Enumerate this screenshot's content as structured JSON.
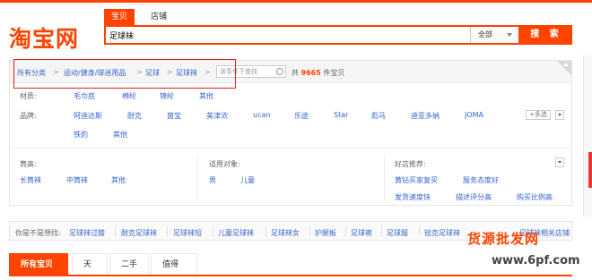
{
  "header": {
    "logo_text": "淘宝网",
    "tabs": [
      {
        "label": "宝贝"
      },
      {
        "label": "店铺"
      }
    ],
    "search_value": "足球袜",
    "scope_label": "全部",
    "search_button": "搜 索"
  },
  "breadcrumb": {
    "items": [
      "所有分类",
      "运动/健身/球迷用品",
      "足球",
      "足球袜"
    ],
    "filter_placeholder": "该条件下查找",
    "count_prefix": "共",
    "count_value": "9665",
    "count_suffix": "件宝贝"
  },
  "attributes": {
    "material": {
      "label": "材质:",
      "values": [
        "毛巾底",
        "棉纶",
        "锦纶",
        "其他"
      ]
    },
    "brand": {
      "label": "品牌:",
      "values_row1": [
        "阿迪达斯",
        "耐克",
        "茵宝",
        "美津浓",
        "ucan",
        "乐途",
        "Star",
        "彪马",
        "迪亚多纳",
        "JOMA"
      ],
      "values_row2": [
        "铁豹",
        "其他"
      ],
      "more_label": "+多选"
    },
    "height": {
      "label": "筒高:",
      "values": [
        "长筒袜",
        "中筒袜",
        "其他"
      ]
    },
    "target": {
      "label": "适用对象:",
      "values": [
        "男",
        "儿童"
      ]
    },
    "shops": {
      "label": "好店推荐:",
      "row1": [
        "黄钻买家复买",
        "服务态度好"
      ],
      "row2": [
        "发货速度快",
        "描述评分高",
        "购买比例高"
      ]
    }
  },
  "guess": {
    "label": "你是不是想找:",
    "items": [
      "足球袜过膝",
      "耐克足球袜",
      "足球袜短",
      "儿童足球袜",
      "足球袜女",
      "护腿板",
      "足球裤",
      "足球服",
      "锐克足球袜",
      "足球袜相关店铺"
    ]
  },
  "bottom_tabs": [
    "所有宝贝",
    "天猫",
    "二手",
    "值得买"
  ],
  "watermark": {
    "text": "货源批发网",
    "url": "www.6pf.com"
  },
  "colors": {
    "accent": "#ff4400",
    "link": "#3366cc",
    "highlight": "#e02020"
  }
}
